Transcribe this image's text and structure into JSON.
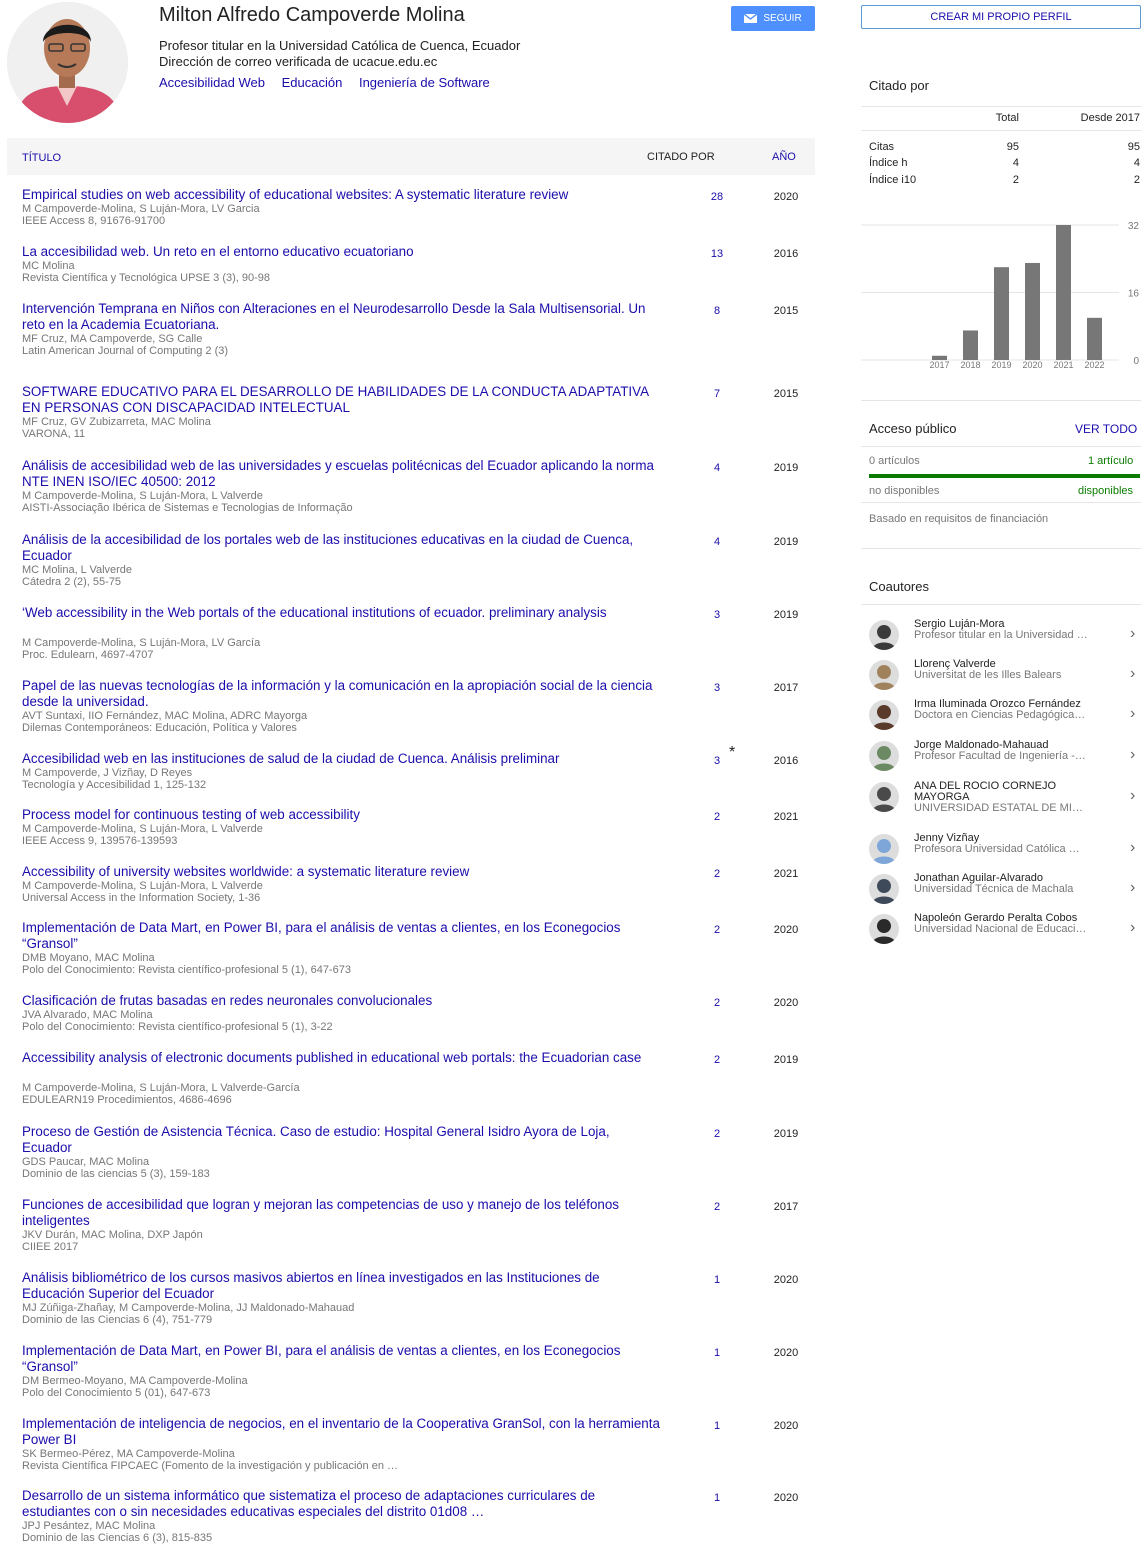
{
  "profile": {
    "name": "Milton Alfredo Campoverde Molina",
    "affiliation": "Profesor titular en la Universidad Católica de Cuenca, Ecuador",
    "email_verified": "Dirección de correo verificada de ucacue.edu.ec",
    "interests": [
      "Accesibilidad Web",
      "Educación",
      "Ingeniería de Software"
    ],
    "follow_label": "SEGUIR"
  },
  "table_header": {
    "title": "TÍTULO",
    "cited_by": "CITADO POR",
    "year": "AÑO"
  },
  "articles": [
    {
      "title": "Empirical studies on web accessibility of educational websites: A systematic literature review",
      "authors": "M Campoverde-Molina, S Luján-Mora, LV Garcia",
      "venue": "IEEE Access 8, 91676-91700",
      "cited": "28",
      "year": "2020"
    },
    {
      "title": "La accesibilidad web. Un reto en el entorno educativo ecuatoriano",
      "authors": "MC Molina",
      "venue": "Revista Científica y Tecnológica UPSE 3 (3), 90-98",
      "cited": "13",
      "year": "2016"
    },
    {
      "title": "Intervención Temprana en Niños con Alteraciones en el Neurodesarrollo Desde la Sala Multisensorial. Un reto en la Academia Ecuatoriana.",
      "authors": "MF Cruz, MA Campoverde, SG Calle",
      "venue": "Latin American Journal of Computing 2 (3)",
      "cited": "8",
      "year": "2015"
    },
    {
      "title": "SOFTWARE EDUCATIVO PARA EL DESARROLLO DE HABILIDADES DE LA CONDUCTA ADAPTATIVA EN PERSONAS CON DISCAPACIDAD INTELECTUAL",
      "authors": "MF Cruz, GV Zubizarreta, MAC Molina",
      "venue": "VARONA, 11",
      "cited": "7",
      "year": "2015"
    },
    {
      "title": "Análisis de accesibilidad web de las universidades y escuelas politécnicas del Ecuador aplicando la norma NTE INEN ISO/IEC 40500: 2012",
      "authors": "M Campoverde-Molina, S Luján-Mora, L Valverde",
      "venue": "AISTI-Associação Ibérica de Sistemas e Tecnologias de Informação",
      "cited": "4",
      "year": "2019"
    },
    {
      "title": "Análisis de la accesibilidad de los portales web de las instituciones educativas en la ciudad de Cuenca, Ecuador",
      "authors": "MC Molina, L Valverde",
      "venue": "Cátedra 2 (2), 55-75",
      "cited": "4",
      "year": "2019"
    },
    {
      "title": "‘Web accessibility in the Web portals of the educational institutions of ecuador. preliminary analysis",
      "authors": "M Campoverde-Molina, S Luján-Mora, LV García",
      "venue": "Proc. Edulearn, 4697-4707",
      "cited": "3",
      "year": "2019"
    },
    {
      "title": "Papel de las nuevas tecnologías de la información y la comunicación en la apropiación social de la ciencia desde la universidad.",
      "authors": "AVT Suntaxi, IIO Fernández, MAC Molina, ADRC Mayorga",
      "venue": "Dilemas Contemporáneos: Educación, Política y Valores",
      "cited": "3",
      "year": "2017"
    },
    {
      "title": "Accesibilidad web en las instituciones de salud de la ciudad de Cuenca. Análisis preliminar",
      "authors": "M Campoverde, J Vizñay, D Reyes",
      "venue": "Tecnología y Accesibilidad 1, 125-132",
      "cited": "3",
      "year": "2016",
      "star": "*"
    },
    {
      "title": "Process model for continuous testing of web accessibility",
      "authors": "M Campoverde-Molina, S Luján-Mora, L Valverde",
      "venue": "IEEE Access 9, 139576-139593",
      "cited": "2",
      "year": "2021"
    },
    {
      "title": "Accessibility of university websites worldwide: a systematic literature review",
      "authors": "M Campoverde-Molina, S Luján-Mora, L Valverde",
      "venue": "Universal Access in the Information Society, 1-36",
      "cited": "2",
      "year": "2021"
    },
    {
      "title": "Implementación de Data Mart, en Power BI, para el análisis de ventas a clientes, en los Econegocios “Gransol”",
      "authors": "DMB Moyano, MAC Molina",
      "venue": "Polo del Conocimiento: Revista científico-profesional 5 (1), 647-673",
      "cited": "2",
      "year": "2020"
    },
    {
      "title": "Clasificación de frutas basadas en redes neuronales convolucionales",
      "authors": "JVA Alvarado, MAC Molina",
      "venue": "Polo del Conocimiento: Revista científico-profesional 5 (1), 3-22",
      "cited": "2",
      "year": "2020"
    },
    {
      "title": "Accessibility analysis of electronic documents published in educational web portals: the Ecuadorian case",
      "authors": "M Campoverde-Molina, S Luján-Mora, L Valverde-García",
      "venue": "EDULEARN19 Procedimientos, 4686-4696",
      "cited": "2",
      "year": "2019"
    },
    {
      "title": "Proceso de Gestión de Asistencia Técnica. Caso de estudio: Hospital General Isidro Ayora de Loja, Ecuador",
      "authors": "GDS Paucar, MAC Molina",
      "venue": "Dominio de las ciencias 5 (3), 159-183",
      "cited": "2",
      "year": "2019"
    },
    {
      "title": "Funciones de accesibilidad que logran y mejoran las competencias de uso y manejo de los teléfonos inteligentes",
      "authors": "JKV Durán, MAC Molina, DXP Japón",
      "venue": "CIIEE 2017",
      "cited": "2",
      "year": "2017"
    },
    {
      "title": "Análisis bibliométrico de los cursos masivos abiertos en línea investigados en las Instituciones de Educación Superior del Ecuador",
      "authors": "MJ Zúñiga-Zhañay, M Campoverde-Molina, JJ Maldonado-Mahauad",
      "venue": "Dominio de las Ciencias 6 (4), 751-779",
      "cited": "1",
      "year": "2020"
    },
    {
      "title": "Implementación de Data Mart, en Power BI, para el análisis de ventas a clientes, en los Econegocios “Gransol”",
      "authors": "DM Bermeo-Moyano, MA Campoverde-Molina",
      "venue": "Polo del Conocimiento 5 (01), 647-673",
      "cited": "1",
      "year": "2020"
    },
    {
      "title": "Implementación de inteligencia de negocios, en el inventario de la Cooperativa GranSol, con la herramienta Power BI",
      "authors": "SK Bermeo-Pérez, MA Campoverde-Molina",
      "venue": "Revista Científica FIPCAEC (Fomento de la investigación y publicación en …",
      "cited": "1",
      "year": "2020"
    },
    {
      "title": "Desarrollo de un sistema informático que sistematiza el proceso de adaptaciones curriculares de estudiantes con o sin necesidades educativas especiales del distrito 01d08 …",
      "authors": "JPJ Pesántez, MAC Molina",
      "venue": "Dominio de las Ciencias 6 (3), 815-835",
      "cited": "1",
      "year": "2020"
    }
  ],
  "sidebar": {
    "create_profile": "CREAR MI PROPIO PERFIL",
    "cited_by_title": "Citado por",
    "metrics_header": {
      "total": "Total",
      "since": "Desde 2017"
    },
    "metrics": [
      {
        "label": "Citas",
        "total": "95",
        "since": "95"
      },
      {
        "label": "Índice h",
        "total": "4",
        "since": "4"
      },
      {
        "label": "Índice i10",
        "total": "2",
        "since": "2"
      }
    ],
    "public_access": {
      "title": "Acceso público",
      "view_all": "VER TODO",
      "unavailable_count": "0 artículos",
      "available_count": "1 artículo",
      "unavailable_label": "no disponibles",
      "available_label": "disponibles",
      "note": "Basado en requisitos de financiación",
      "available_color": "#0a7b00"
    },
    "coauthors_title": "Coautores",
    "coauthors": [
      {
        "name": "Sergio Luján-Mora",
        "affil": "Profesor titular en la Universidad …"
      },
      {
        "name": "Llorenç Valverde",
        "affil": "Universitat de les Illes Balears"
      },
      {
        "name": "Irma Iluminada Orozco Fernández",
        "affil": "Doctora en Ciencias Pedagógica…"
      },
      {
        "name": "Jorge Maldonado-Mahauad",
        "affil": "Profesor Facultad de Ingeniería -…"
      },
      {
        "name": "ANA DEL ROCIO CORNEJO MAYORGA",
        "affil": "UNIVERSIDAD ESTATAL DE MI…"
      },
      {
        "name": "Jenny Vizñay",
        "affil": "Profesora Universidad Católica …"
      },
      {
        "name": "Jonathan Aguilar-Alvarado",
        "affil": "Universidad Técnica de Machala"
      },
      {
        "name": "Napoleón Gerardo Peralta Cobos",
        "affil": "Universidad Nacional de Educaci…"
      }
    ]
  },
  "chart_data": {
    "type": "bar",
    "categories": [
      "2017",
      "2018",
      "2019",
      "2020",
      "2021",
      "2022"
    ],
    "values": [
      1,
      7,
      22,
      23,
      32,
      10
    ],
    "ylim": [
      0,
      32
    ],
    "yticks": [
      "0",
      "16",
      "32"
    ],
    "bar_color": "#777777"
  }
}
